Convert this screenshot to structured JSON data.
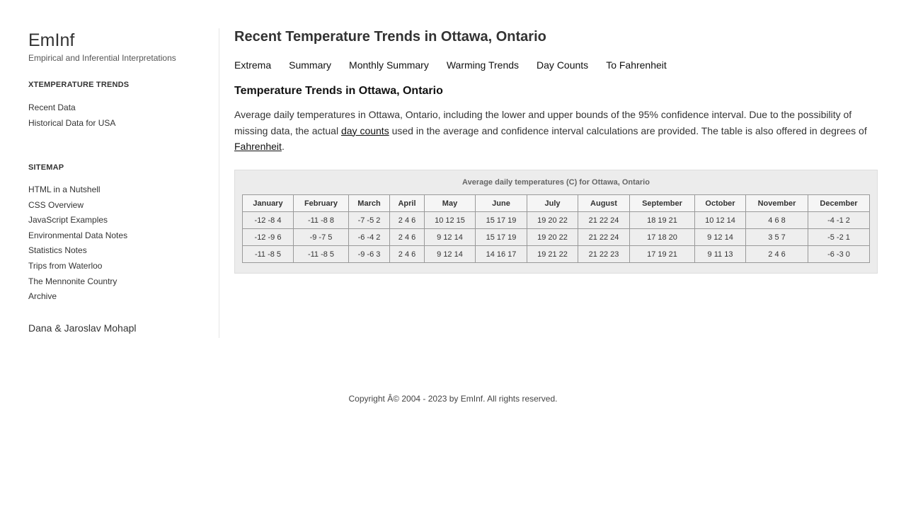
{
  "sidebar": {
    "site_title": "EmInf",
    "site_subtitle": "Empirical and Inferential Interpretations",
    "trends_heading": "XTEMPERATURE TRENDS",
    "trends_items": [
      "Recent Data",
      "Historical Data for USA"
    ],
    "sitemap_heading": "SITEMAP",
    "sitemap_items": [
      "HTML in a Nutshell",
      "CSS Overview",
      "JavaScript Examples",
      "Environmental Data Notes",
      "Statistics Notes",
      "Trips from Waterloo",
      "The Mennonite Country",
      "Archive"
    ],
    "authors": "Dana & Jaroslav Mohapl"
  },
  "main": {
    "title": "Recent Temperature Trends in Ottawa, Ontario",
    "tabs": [
      "Extrema",
      "Summary",
      "Monthly Summary",
      "Warming Trends",
      "Day Counts",
      "To Fahrenheit"
    ],
    "section_title": "Temperature Trends in Ottawa, Ontario",
    "desc_part1": "Average daily temperatures in Ottawa, Ontario, including the lower and upper bounds of the 95% confidence interval. Due to the possibility of missing data, the actual ",
    "desc_link1": "day counts",
    "desc_part2": " used in the average and confidence interval calculations are provided. The table is also offered in degrees of ",
    "desc_link2": "Fahrenheit",
    "desc_part3": ".",
    "table": {
      "caption": "Average daily temperatures (C) for Ottawa, Ontario",
      "columns": [
        "January",
        "February",
        "March",
        "April",
        "May",
        "June",
        "July",
        "August",
        "September",
        "October",
        "November",
        "December"
      ],
      "rows": [
        [
          "-12 -8 4",
          "-11 -8 8",
          "-7 -5 2",
          "2 4 6",
          "10 12 15",
          "15 17 19",
          "19 20 22",
          "21 22 24",
          "18 19 21",
          "10 12 14",
          "4 6 8",
          "-4 -1 2"
        ],
        [
          "-12 -9 6",
          "-9 -7 5",
          "-6 -4 2",
          "2 4 6",
          "9 12 14",
          "15 17 19",
          "19 20 22",
          "21 22 24",
          "17 18 20",
          "9 12 14",
          "3 5 7",
          "-5 -2 1"
        ],
        [
          "-11 -8 5",
          "-11 -8 5",
          "-9 -6 3",
          "2 4 6",
          "9 12 14",
          "14 16 17",
          "19 21 22",
          "21 22 23",
          "17 19 21",
          "9 11 13",
          "2 4 6",
          "-6 -3 0"
        ]
      ]
    }
  },
  "footer": {
    "text": "Copyright Â© 2004 - 2023 by EmInf. All rights reserved."
  }
}
